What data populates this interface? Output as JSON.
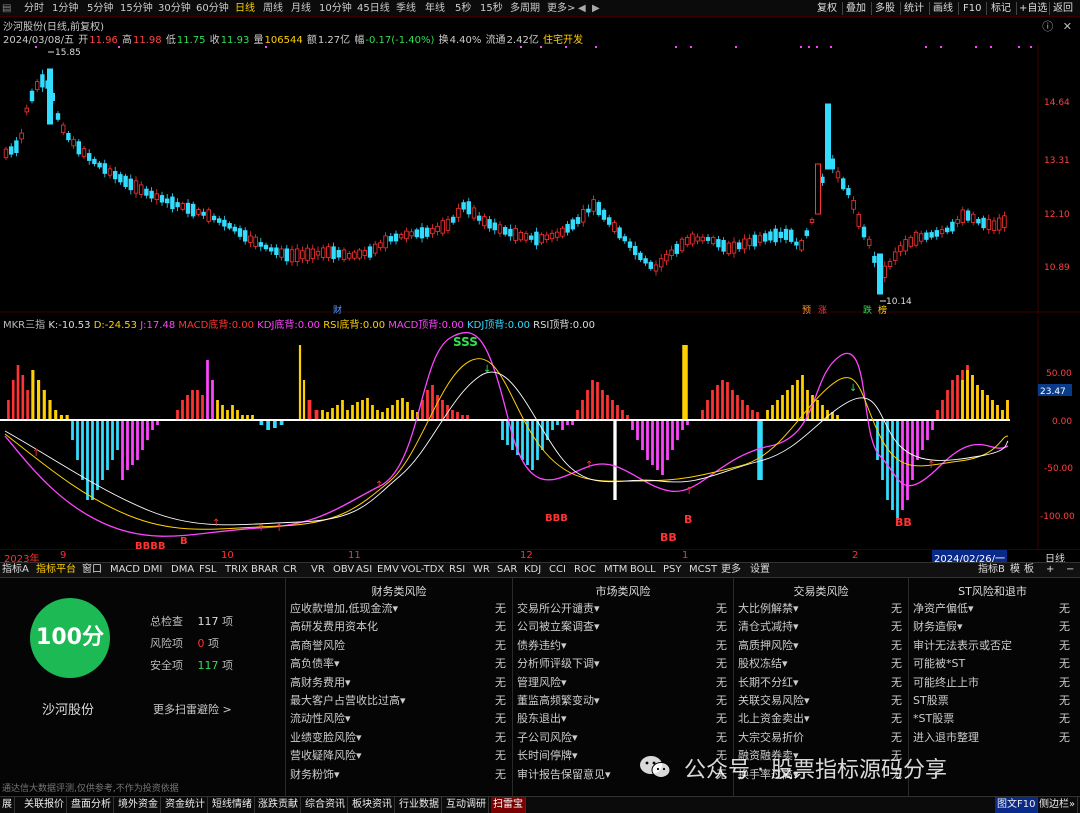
{
  "topbar": {
    "timeframes": [
      "分时",
      "1分钟",
      "5分钟",
      "15分钟",
      "30分钟",
      "60分钟",
      "日线",
      "周线",
      "月线",
      "10分钟",
      "45日线",
      "季线",
      "年线",
      "5秒",
      "15秒",
      "多周期",
      "更多>"
    ],
    "active_timeframe": "日线",
    "right_tools": [
      "复权",
      "叠加",
      "多股",
      "统计",
      "画线",
      "F10",
      "标记",
      "+自选",
      "返回"
    ]
  },
  "stock": {
    "title": "沙河股份(日线,前复权)",
    "date": "2024/03/08/五",
    "open_label": "开",
    "open": "11.96",
    "high_label": "高",
    "high": "11.98",
    "low_label": "低",
    "low": "11.75",
    "close_label": "收",
    "close": "11.93",
    "volume_label": "量",
    "volume": "106544",
    "amount_label": "额",
    "amount": "1.27亿",
    "change_label": "幅",
    "change": "-0.17(-1.40%)",
    "turnover_label": "换",
    "turnover": "4.40%",
    "float_label": "流通",
    "float": "2.42亿",
    "sector": "住宅开发"
  },
  "kline": {
    "price_labels": [
      "14.64",
      "13.31",
      "12.10",
      "10.89"
    ],
    "high_mark": "15.85",
    "low_mark": "10.14",
    "events": [
      "财",
      "预",
      "涨",
      "跌",
      "榜"
    ],
    "colors": {
      "up": "#ff3333",
      "down": "#33ddff",
      "bg": "#000000"
    }
  },
  "indicator": {
    "name": "MKR三指",
    "k_label": "K:",
    "k": "-10.53",
    "d_label": "D:",
    "d": "-24.53",
    "j_label": "J:",
    "j": "17.48",
    "macd_bottom_label": "MACD底背:",
    "macd_bottom": "0.00",
    "kdj_bottom_label": "KDJ底背:",
    "kdj_bottom": "0.00",
    "rsi_bottom_label": "RSI底背:",
    "rsi_bottom": "0.00",
    "macd_top_label": "MACD顶背:",
    "macd_top": "0.00",
    "kdj_top_label": "KDJ顶背:",
    "kdj_top": "0.00",
    "rsi_top_label": "RSI顶背:",
    "rsi_top": "0.00",
    "axis_labels": [
      "50.00",
      "0.00",
      "-50.00",
      "-100.00"
    ],
    "current_value": "23.47",
    "signal_marks": [
      "SSS",
      "BBBB",
      "B",
      "BBB",
      "BB",
      "B",
      "BB"
    ]
  },
  "datebar": {
    "year": "2023年",
    "months": [
      "9",
      "10",
      "11",
      "12",
      "1",
      "2"
    ],
    "current_date": "2024/02/26/一",
    "period": "日线"
  },
  "tabs": [
    "指标A",
    "指标平台",
    "窗口",
    "MACD",
    "DMI",
    "DMA",
    "FSL",
    "TRIX",
    "BRAR",
    "CR",
    "VR",
    "OBV",
    "ASI",
    "EMV",
    "VOL-TDX",
    "RSI",
    "WR",
    "SAR",
    "KDJ",
    "CCI",
    "ROC",
    "MTM",
    "BOLL",
    "PSY",
    "MCST",
    "更多",
    "设置"
  ],
  "tabs_right": [
    "指标B",
    "模",
    "板"
  ],
  "risk": {
    "score": "100分",
    "stock_name": "沙河股份",
    "total_label": "总检查",
    "total": "117",
    "total_unit": "项",
    "risk_label": "风险项",
    "risk": "0",
    "risk_unit": "项",
    "safe_label": "安全项",
    "safe": "117",
    "safe_unit": "项",
    "more_scan": "更多扫雷避险 >",
    "disclaimer": "通达信大数据评测,仅供参考,不作为投资依据",
    "columns": [
      {
        "title": "财务类风险",
        "items": [
          {
            "label": "应收款增加,低现金流▾",
            "value": "无"
          },
          {
            "label": "高研发费用资本化",
            "value": "无"
          },
          {
            "label": "高商誉风险",
            "value": "无"
          },
          {
            "label": "高负债率▾",
            "value": "无"
          },
          {
            "label": "高财务费用▾",
            "value": "无"
          },
          {
            "label": "最大客户占营收比过高▾",
            "value": "无"
          },
          {
            "label": "流动性风险▾",
            "value": "无"
          },
          {
            "label": "业绩变脸风险▾",
            "value": "无"
          },
          {
            "label": "营收疑降风险▾",
            "value": "无"
          },
          {
            "label": "财务粉饰▾",
            "value": "无"
          }
        ]
      },
      {
        "title": "市场类风险",
        "items": [
          {
            "label": "交易所公开谴责▾",
            "value": "无"
          },
          {
            "label": "公司被立案调查▾",
            "value": "无"
          },
          {
            "label": "债券违约▾",
            "value": "无"
          },
          {
            "label": "分析师评级下调▾",
            "value": "无"
          },
          {
            "label": "管理风险▾",
            "value": "无"
          },
          {
            "label": "董监高频繁变动▾",
            "value": "无"
          },
          {
            "label": "股东退出▾",
            "value": "无"
          },
          {
            "label": "子公司风险▾",
            "value": "无"
          },
          {
            "label": "长时间停牌▾",
            "value": "无"
          },
          {
            "label": "审计报告保留意见▾",
            "value": "无"
          }
        ]
      },
      {
        "title": "交易类风险",
        "items": [
          {
            "label": "大比例解禁▾",
            "value": "无"
          },
          {
            "label": "清仓式减持▾",
            "value": "无"
          },
          {
            "label": "高质押风险▾",
            "value": "无"
          },
          {
            "label": "股权冻结▾",
            "value": "无"
          },
          {
            "label": "长期不分红▾",
            "value": "无"
          },
          {
            "label": "关联交易风险▾",
            "value": "无"
          },
          {
            "label": "北上资金卖出▾",
            "value": "无"
          },
          {
            "label": "大宗交易折价",
            "value": "无"
          },
          {
            "label": "融资融券卖▾",
            "value": "无"
          },
          {
            "label": "换手率过高▾",
            "value": "无"
          }
        ]
      },
      {
        "title": "ST风险和退市",
        "items": [
          {
            "label": "净资产偏低▾",
            "value": "无"
          },
          {
            "label": "财务造假▾",
            "value": "无"
          },
          {
            "label": "审计无法表示或否定",
            "value": "无"
          },
          {
            "label": "可能被*ST",
            "value": "无"
          },
          {
            "label": "可能终止上市",
            "value": "无"
          },
          {
            "label": "ST股票",
            "value": "无"
          },
          {
            "label": "*ST股票",
            "value": "无"
          },
          {
            "label": "进入退市整理",
            "value": "无"
          }
        ]
      }
    ]
  },
  "bottombar": [
    "展",
    "关联报价",
    "盘面分析",
    "境外资金",
    "资金统计",
    "短线情绪",
    "涨跌贡献",
    "综合资讯",
    "板块资讯",
    "行业数据",
    "互动调研",
    "扫雷宝"
  ],
  "bottombar_active": "扫雷宝",
  "bottombar_right": "图文F10",
  "bottombar_right2": "侧边栏»",
  "watermark": "公众号 · 股票指标源码分享"
}
